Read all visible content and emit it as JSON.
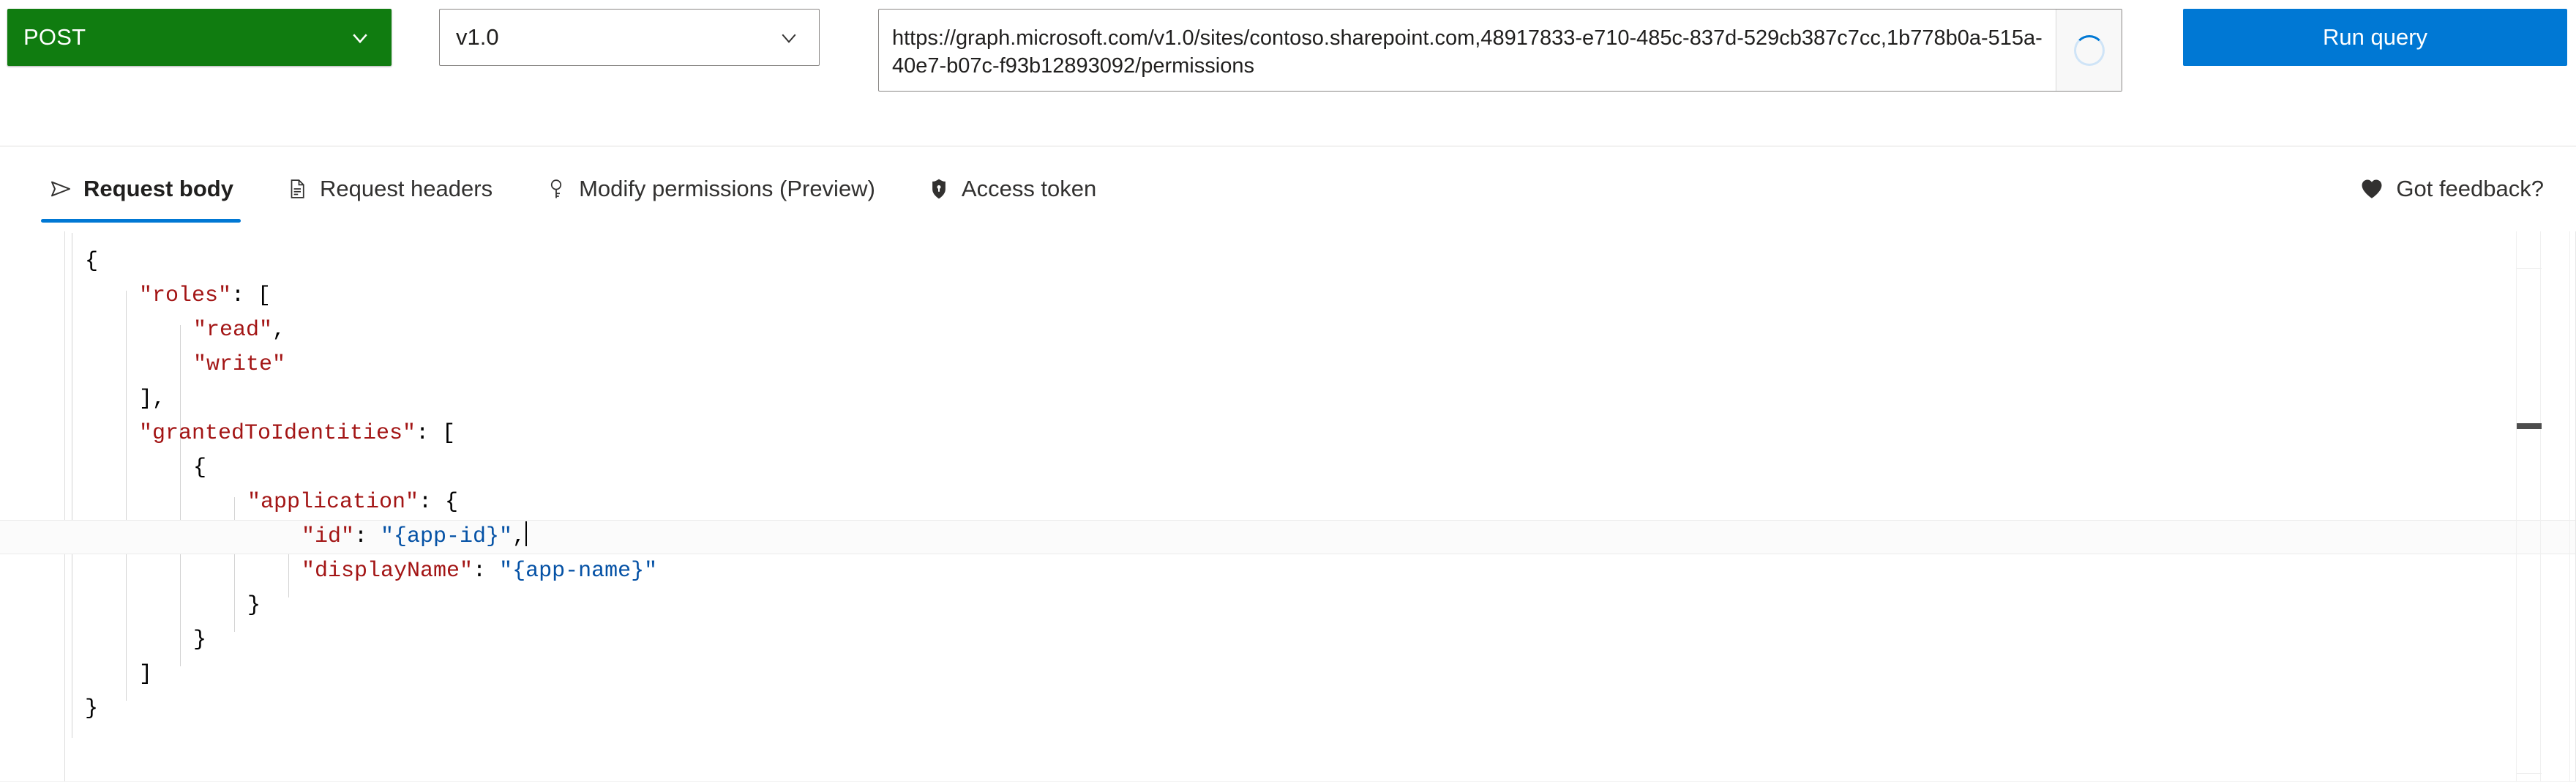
{
  "query_bar": {
    "method": {
      "value": "POST",
      "icon": "chevron-down-icon"
    },
    "version": {
      "value": "v1.0",
      "icon": "chevron-down-icon"
    },
    "url": {
      "value": "https://graph.microsoft.com/v1.0/sites/contoso.sharepoint.com,48917833-e710-485c-837d-529cb387c7cc,1b778b0a-515a-40e7-b07c-f93b12893092/permissions",
      "placeholder": "https://graph.microsoft.com/v1.0/me",
      "loading_icon": "spinner-icon"
    },
    "run_query_label": "Run query"
  },
  "tabs": [
    {
      "label": "Request body",
      "icon": "send-arrow-icon",
      "active": true
    },
    {
      "label": "Request headers",
      "icon": "document-icon",
      "active": false
    },
    {
      "label": "Modify permissions (Preview)",
      "icon": "key-icon",
      "active": false
    },
    {
      "label": "Access token",
      "icon": "shield-lock-icon",
      "active": false
    }
  ],
  "feedback": {
    "label": "Got feedback?",
    "icon": "heart-icon"
  },
  "editor": {
    "language": "json",
    "lines": [
      {
        "indent": 0,
        "tokens": [
          {
            "t": "{",
            "c": "punct"
          }
        ]
      },
      {
        "indent": 1,
        "tokens": [
          {
            "t": "\"roles\"",
            "c": "key"
          },
          {
            "t": ": [",
            "c": "punct"
          }
        ]
      },
      {
        "indent": 2,
        "tokens": [
          {
            "t": "\"read\"",
            "c": "key"
          },
          {
            "t": ",",
            "c": "punct"
          }
        ]
      },
      {
        "indent": 2,
        "tokens": [
          {
            "t": "\"write\"",
            "c": "key"
          }
        ]
      },
      {
        "indent": 1,
        "tokens": [
          {
            "t": "],",
            "c": "punct"
          }
        ]
      },
      {
        "indent": 1,
        "tokens": [
          {
            "t": "\"grantedToIdentities\"",
            "c": "key"
          },
          {
            "t": ": [",
            "c": "punct"
          }
        ]
      },
      {
        "indent": 2,
        "tokens": [
          {
            "t": "{",
            "c": "punct"
          }
        ]
      },
      {
        "indent": 3,
        "tokens": [
          {
            "t": "\"application\"",
            "c": "key"
          },
          {
            "t": ": {",
            "c": "punct"
          }
        ]
      },
      {
        "indent": 4,
        "highlight": true,
        "caret": true,
        "tokens": [
          {
            "t": "\"id\"",
            "c": "key"
          },
          {
            "t": ": ",
            "c": "punct"
          },
          {
            "t": "\"{app-id}\"",
            "c": "str"
          },
          {
            "t": ",",
            "c": "punct"
          }
        ]
      },
      {
        "indent": 4,
        "tokens": [
          {
            "t": "\"displayName\"",
            "c": "key"
          },
          {
            "t": ": ",
            "c": "punct"
          },
          {
            "t": "\"{app-name}\"",
            "c": "str"
          }
        ]
      },
      {
        "indent": 3,
        "tokens": [
          {
            "t": "}",
            "c": "punct"
          }
        ]
      },
      {
        "indent": 2,
        "tokens": [
          {
            "t": "}",
            "c": "punct"
          }
        ]
      },
      {
        "indent": 1,
        "tokens": [
          {
            "t": "]",
            "c": "punct"
          }
        ]
      },
      {
        "indent": 0,
        "tokens": [
          {
            "t": "}",
            "c": "punct"
          }
        ]
      }
    ]
  },
  "colors": {
    "method_green": "#107C10",
    "run_query_blue": "#0078d4",
    "tab_underline": "#0078d4",
    "json_key": "#a31515",
    "json_string": "#0451a5",
    "border": "#8a8886"
  }
}
